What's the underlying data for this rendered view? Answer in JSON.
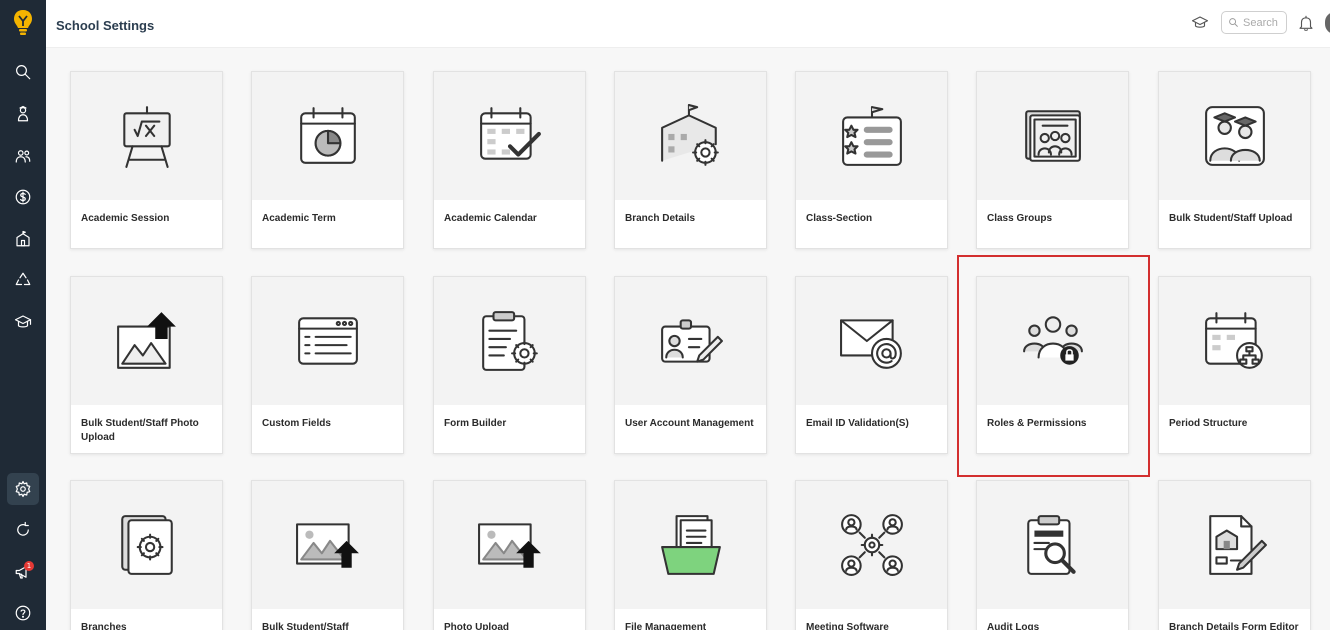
{
  "header": {
    "title": "School Settings",
    "search_placeholder": "Search"
  },
  "sidebar": {
    "notification_count": "1",
    "items": [
      {
        "icon": "search-icon"
      },
      {
        "icon": "student-icon"
      },
      {
        "icon": "users-icon"
      },
      {
        "icon": "dollar-icon"
      },
      {
        "icon": "building-icon"
      },
      {
        "icon": "recycle-icon"
      },
      {
        "icon": "graduation-icon"
      },
      {
        "icon": "gear-icon"
      },
      {
        "icon": "refresh-icon"
      },
      {
        "icon": "megaphone-icon"
      },
      {
        "icon": "help-icon"
      }
    ]
  },
  "cards": [
    {
      "label": "Academic Session",
      "icon": "easel-icon"
    },
    {
      "label": "Academic Term",
      "icon": "calendar-pie-icon"
    },
    {
      "label": "Academic Calendar",
      "icon": "calendar-check-icon"
    },
    {
      "label": "Branch Details",
      "icon": "school-gear-icon"
    },
    {
      "label": "Class-Section",
      "icon": "class-list-icon"
    },
    {
      "label": "Class Groups",
      "icon": "group-photo-icon"
    },
    {
      "label": "Bulk Student/Staff Upload",
      "icon": "graduates-icon"
    },
    {
      "label": "Bulk Student/Staff Photo Upload",
      "icon": "photo-upload-icon"
    },
    {
      "label": "Custom Fields",
      "icon": "form-window-icon"
    },
    {
      "label": "Form Builder",
      "icon": "clipboard-gear-icon"
    },
    {
      "label": "User Account Management",
      "icon": "id-card-icon"
    },
    {
      "label": "Email ID Validation(S)",
      "icon": "email-at-icon"
    },
    {
      "label": "Roles & Permissions",
      "icon": "roles-lock-icon"
    },
    {
      "label": "Period Structure",
      "icon": "calendar-hierarchy-icon"
    },
    {
      "label": "Branches",
      "icon": "document-gear-icon"
    },
    {
      "label": "Bulk Student/Staff",
      "icon": "image-upload-icon"
    },
    {
      "label": "Photo Upload",
      "icon": "image-upload-icon"
    },
    {
      "label": "File Management",
      "icon": "folder-files-icon"
    },
    {
      "label": "Meeting Software",
      "icon": "meeting-network-icon"
    },
    {
      "label": "Audit Logs",
      "icon": "clipboard-search-icon"
    },
    {
      "label": "Branch Details Form Editor",
      "icon": "school-form-edit-icon"
    }
  ],
  "colors": {
    "sidebar_bg": "#1f2a36",
    "highlight": "#d32f2f",
    "accent_green": "#7ed37e",
    "logo_yellow": "#f4b400"
  }
}
